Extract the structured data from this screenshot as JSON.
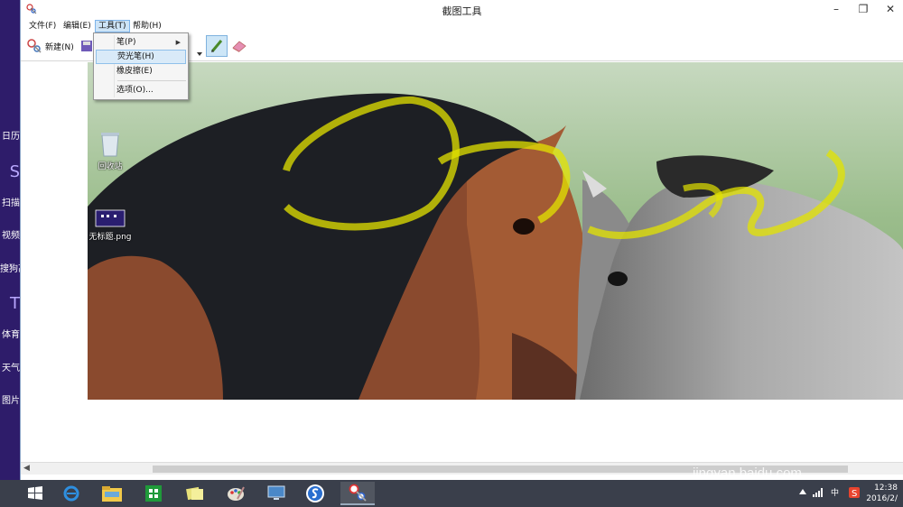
{
  "window": {
    "title": "截图工具"
  },
  "menubar": {
    "file": "文件(F)",
    "edit": "编辑(E)",
    "tools": "工具(T)",
    "help": "帮助(H)"
  },
  "toolbar": {
    "new_label": "新建(N)"
  },
  "tools_menu": {
    "items": [
      {
        "label": "笔(P)",
        "has_submenu": true
      },
      {
        "label": "荧光笔(H)",
        "highlighted": true
      },
      {
        "label": "橡皮擦(E)"
      },
      {
        "label": "选项(O)..."
      }
    ]
  },
  "start_strip": [
    "日历",
    "S",
    "扫描",
    "视频",
    "搜狗高",
    "T",
    "体育",
    "天气",
    "图片"
  ],
  "desktop_icons": [
    {
      "label": "回收站",
      "icon": "recycle-bin-icon"
    },
    {
      "label": "无标题.png",
      "icon": "image-file-icon"
    }
  ],
  "taskbar": {
    "apps": [
      "start-icon",
      "ie-icon",
      "file-explorer-icon",
      "store-icon",
      "sticky-notes-icon",
      "paint-icon",
      "remote-desktop-icon",
      "sogou-icon",
      "snipping-tool-icon"
    ],
    "tray_ime": "中",
    "time": "12:38",
    "date": "2016/2/"
  },
  "watermark": {
    "brand": "Bai",
    "brand2": "du",
    "brand_cn": "经验",
    "url": "jingyan.baidu.com"
  },
  "colors": {
    "menu_highlight": "#d9eaf8",
    "taskbar": "#3a3f4b",
    "start_strip": "#2e1c6a",
    "highlighter": "#e6e600"
  }
}
